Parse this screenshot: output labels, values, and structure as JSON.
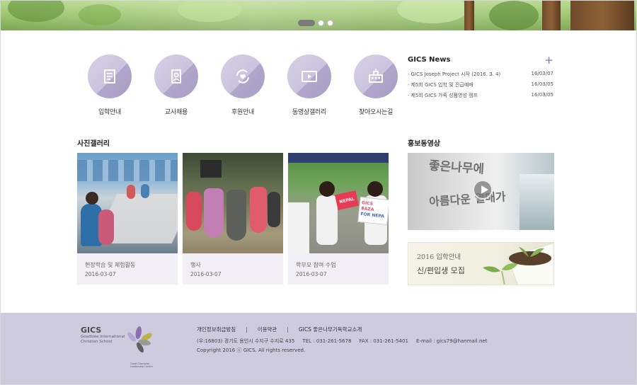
{
  "slider": {
    "active_index": 0,
    "count": 3
  },
  "quick_menu": [
    {
      "label": "입학안내",
      "icon": "document-icon"
    },
    {
      "label": "교사채용",
      "icon": "id-card-icon"
    },
    {
      "label": "후원안내",
      "icon": "heart-icon"
    },
    {
      "label": "동영상갤러리",
      "icon": "video-icon"
    },
    {
      "label": "찾아오시는길",
      "icon": "building-icon"
    }
  ],
  "news": {
    "title": "GICS News",
    "more": "+",
    "items": [
      {
        "title": "GICS Joseph Project 시작 (2016. 3. 4)",
        "date": "16/03/07"
      },
      {
        "title": "제5회 GICS 입학 및 진급예배",
        "date": "16/03/05"
      },
      {
        "title": "제5회 GICS 가족 성품영성 캠프",
        "date": "16/03/05"
      }
    ]
  },
  "gallery": {
    "title": "사진갤러리",
    "items": [
      {
        "title": "현장학습 및 체험활동",
        "date": "2016-03-07"
      },
      {
        "title": "행사",
        "date": "2016-03-07"
      },
      {
        "title": "학부모 참여 수업",
        "date": "2016-03-07"
      }
    ],
    "sign_text": [
      "NEPAL",
      "GICS BAZA",
      "FOR NEPA"
    ]
  },
  "video": {
    "title": "홍보동영상",
    "wall_text": [
      "좋은나무에",
      "아름다운 열매가"
    ]
  },
  "admission": {
    "line1": "2016 입학안내",
    "line2": "신/편입생 모집"
  },
  "footer": {
    "logo_big": "GICS",
    "logo_small": [
      "Goodtree International",
      "Christian School"
    ],
    "logo_tiny": "Good Character Leadership Center",
    "links": [
      "개인정보취급방침",
      "이용약관",
      "GICS 좋은나무기독학교소개"
    ],
    "separator": "|",
    "info": "(우:16803) 경기도 용인시 수지구 수지로 435     TEL : 031-261-5678     FAX : 031-261-5401     E-mail : gics79@hanmail.net",
    "copyright": "Copyright 2016 ⓒ GICS. All rights reserved."
  },
  "colors": {
    "accent": "#7d73a6",
    "circle_light": "#d6d0e6",
    "circle_dark": "#a99fc5",
    "footer_bg": "#cfcbdf",
    "card_bg": "#f2f0f6"
  }
}
